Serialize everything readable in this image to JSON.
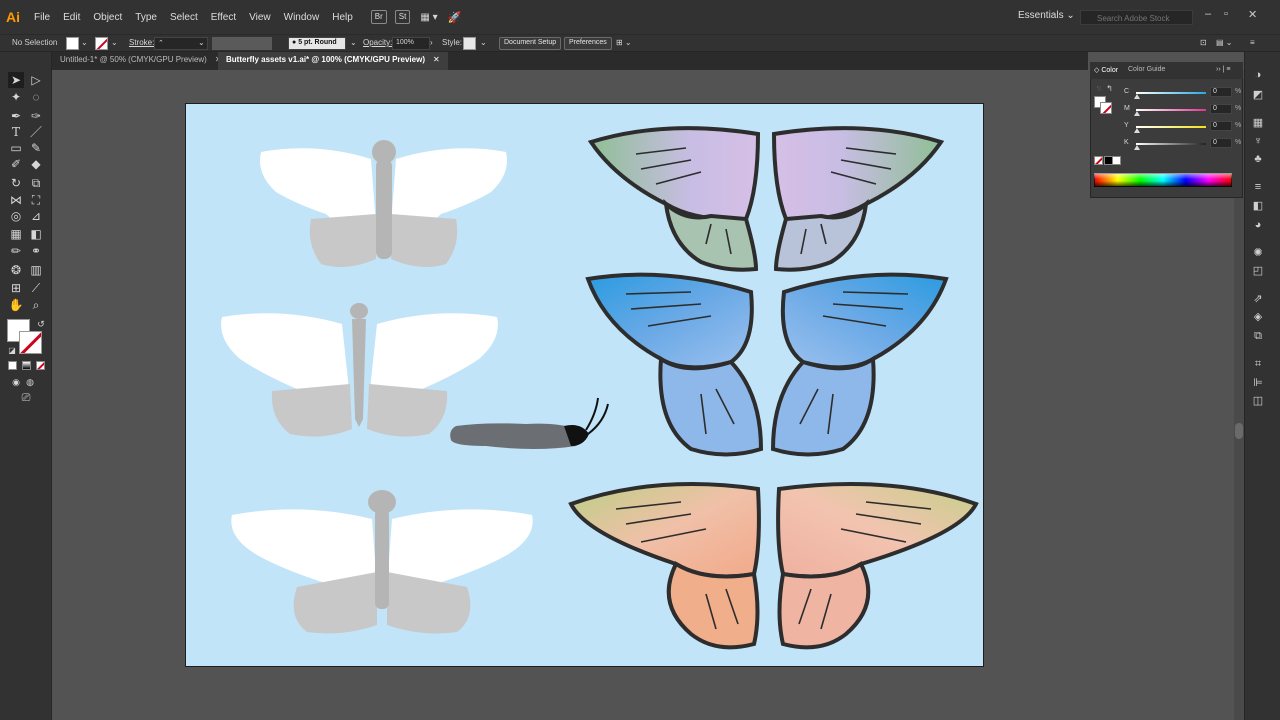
{
  "app": {
    "logo": "Ai"
  },
  "menu": [
    "File",
    "Edit",
    "Object",
    "Type",
    "Select",
    "Effect",
    "View",
    "Window",
    "Help"
  ],
  "bridge_chips": [
    "Br",
    "St"
  ],
  "workspace": {
    "label": "Essentials"
  },
  "stock_search": {
    "placeholder": "Search Adobe Stock"
  },
  "control_bar": {
    "selection": "No Selection",
    "stroke_label": "Stroke:",
    "brush": "5 pt. Round",
    "opacity_label": "Opacity:",
    "opacity_value": "100%",
    "style_label": "Style:",
    "document_setup": "Document Setup",
    "preferences": "Preferences"
  },
  "tabs": [
    {
      "label": "Untitled-1* @ 50% (CMYK/GPU Preview)",
      "active": false
    },
    {
      "label": "Butterfly assets v1.ai* @ 100% (CMYK/GPU Preview)",
      "active": true
    }
  ],
  "color_panel": {
    "tabs": [
      "Color",
      "Color Guide"
    ],
    "channels": [
      {
        "label": "C",
        "value": "0",
        "color": "#2aa7e0"
      },
      {
        "label": "M",
        "value": "0",
        "color": "#e0348f"
      },
      {
        "label": "Y",
        "value": "0",
        "color": "#f4e11a"
      },
      {
        "label": "K",
        "value": "0",
        "color": "#222222"
      }
    ],
    "percent": "%"
  },
  "colors": {
    "artboard": "#c2e4f8",
    "wing_green": "#9cc4a0",
    "wing_lilac": "#cdbde6",
    "wing_blue": "#6faee8",
    "wing_peach": "#f2b496",
    "wing_olive": "#c8cf8a",
    "silhouette_white": "#ffffff",
    "silhouette_gray": "#c8c8c8"
  }
}
